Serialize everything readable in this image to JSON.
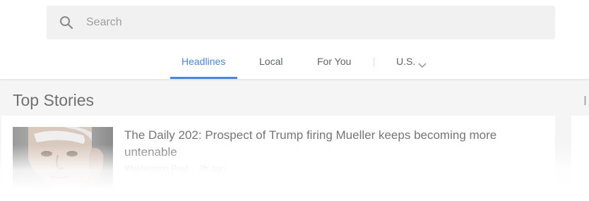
{
  "search": {
    "placeholder": "Search",
    "value": "",
    "icon": "search-icon"
  },
  "tabs": [
    {
      "label": "Headlines",
      "active": true
    },
    {
      "label": "Local",
      "active": false
    },
    {
      "label": "For You",
      "active": false
    }
  ],
  "edition": {
    "label": "U.S.",
    "icon": "chevron-down-icon"
  },
  "colors": {
    "accent": "#4285f4",
    "search_bg": "#f1f1f1",
    "page_bg": "#f5f5f5"
  },
  "main": {
    "section_title": "Top Stories",
    "right_section_title": "I",
    "stories": [
      {
        "headline": "The Daily 202: Prospect of Trump firing Mueller keeps becoming more untenable",
        "source": "Washington Post",
        "time": "2h ago"
      }
    ]
  }
}
